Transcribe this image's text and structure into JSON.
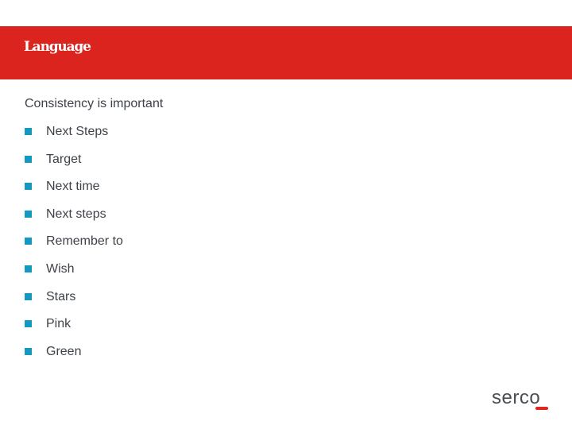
{
  "slide": {
    "title": "Language",
    "subtitle": "Consistency is important",
    "bullets": [
      {
        "label": "Next Steps"
      },
      {
        "label": "Target"
      },
      {
        "label": "Next time"
      },
      {
        "label": "Next steps"
      },
      {
        "label": "Remember to"
      },
      {
        "label": "Wish"
      },
      {
        "label": "Stars"
      },
      {
        "label": "Pink"
      },
      {
        "label": "Green"
      }
    ]
  },
  "logo": {
    "text": "serco"
  },
  "colors": {
    "title_bar": "#dc241f",
    "bullet": "#1398c1",
    "text": "#3e4249",
    "logo_accent": "#e2261f"
  }
}
